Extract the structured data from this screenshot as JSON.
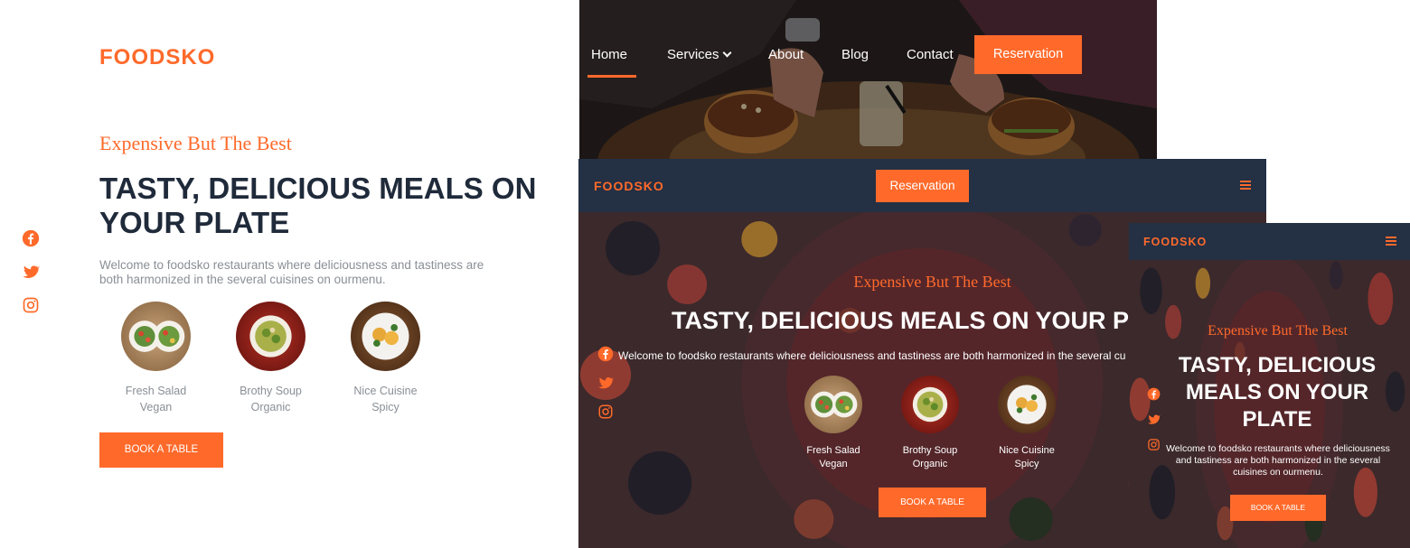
{
  "brand": {
    "name": "FOODSKO",
    "accent": "#ff6a2b",
    "dark": "#243044"
  },
  "hero": {
    "tagline": "Expensive But The Best",
    "title": "TASTY, DELICIOUS MEALS ON YOUR PLATE",
    "tablet_title": "TASTY, DELICIOUS MEALS ON YOUR P",
    "description": "Welcome to foodsko restaurants where deliciousness and tastiness are both harmonized in the several cuisines on ourmenu.",
    "desc_line1": "Welcome to foodsko restaurants where deliciousness and tastiness are",
    "desc_line2": "both harmonized in the several cuisines on ourmenu.",
    "tablet_desc": "Welcome to foodsko restaurants where deliciousness and tastiness are both harmonized in the several cu",
    "book_label": "BOOK A TABLE"
  },
  "dishes": [
    {
      "name": "Fresh Salad",
      "tag": "Vegan"
    },
    {
      "name": "Brothy Soup",
      "tag": "Organic"
    },
    {
      "name": "Nice Cuisine",
      "tag": "Spicy"
    }
  ],
  "social": [
    "facebook-icon",
    "twitter-icon",
    "instagram-icon"
  ],
  "nav": {
    "items": [
      {
        "label": "Home",
        "active": true
      },
      {
        "label": "Services",
        "dropdown": true
      },
      {
        "label": "About"
      },
      {
        "label": "Blog"
      },
      {
        "label": "Contact"
      }
    ],
    "reservation_label": "Reservation"
  }
}
